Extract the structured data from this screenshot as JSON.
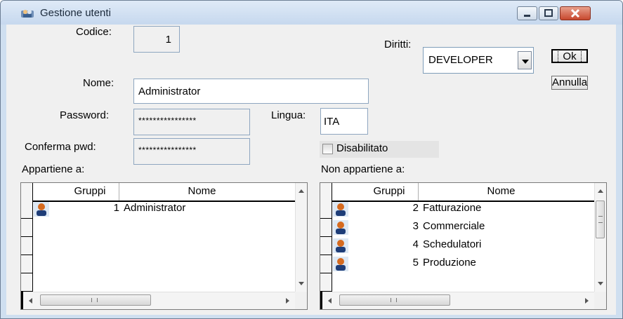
{
  "window": {
    "title": "Gestione utenti",
    "icon": "users-app-icon"
  },
  "form": {
    "codice_label": "Codice:",
    "codice_value": "1",
    "nome_label": "Nome:",
    "nome_value": "Administrator",
    "password_label": "Password:",
    "password_value": "****************",
    "conferma_label": "Conferma pwd:",
    "conferma_value": "****************",
    "lingua_label": "Lingua:",
    "lingua_value": "ITA",
    "diritti_label": "Diritti:",
    "diritti_value": "DEVELOPER",
    "disabilitato_label": "Disabilitato",
    "disabilitato_checked": false
  },
  "buttons": {
    "ok": "Ok",
    "annulla": "Annulla"
  },
  "appartiene": {
    "label": "Appartiene a:",
    "columns": [
      "Gruppi",
      "Nome"
    ],
    "rows": [
      {
        "num": "1",
        "name": "Administrator"
      }
    ]
  },
  "non_appartiene": {
    "label": "Non appartiene a:",
    "columns": [
      "Gruppi",
      "Nome"
    ],
    "rows": [
      {
        "num": "2",
        "name": "Fatturazione"
      },
      {
        "num": "3",
        "name": "Commerciale"
      },
      {
        "num": "4",
        "name": "Schedulatori"
      },
      {
        "num": "5",
        "name": "Produzione"
      }
    ]
  },
  "colors": {
    "titlebar": "#c6d8ee",
    "close_button": "#c7482e",
    "client_bg": "#f0f0f0"
  }
}
